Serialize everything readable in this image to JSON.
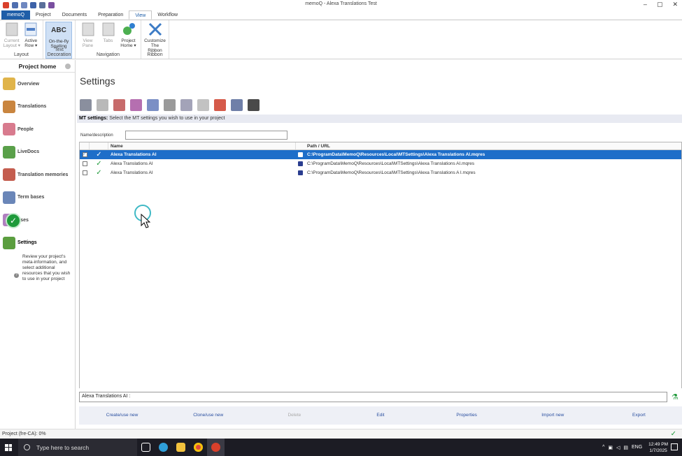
{
  "window": {
    "title": "memoQ - Alexa Translations Test",
    "controls": [
      "–",
      "▢",
      "✕"
    ]
  },
  "ribbon_tabs": [
    "memoQ",
    "Project",
    "Documents",
    "Preparation",
    "View",
    "Workflow"
  ],
  "ribbon": {
    "layout": {
      "label": "Layout",
      "current_layout": "Current Layout ▾",
      "active_row": "Active Row ▾"
    },
    "text_decoration": {
      "label": "Text Decoration",
      "spelling": "On-the-fly Spelling",
      "icon_text": "ABC"
    },
    "navigation": {
      "label": "Navigation",
      "view_pane": "View Pane",
      "tabs": "Tabs",
      "project_home": "Project Home ▾"
    },
    "ribbon_group": {
      "label": "Ribbon",
      "customize": "Customize The Ribbon"
    }
  },
  "nav": {
    "header": "Project home",
    "items": [
      "Overview",
      "Translations",
      "People",
      "LiveDocs",
      "Translation memories",
      "Term bases",
      "uses",
      "Settings"
    ],
    "settings_desc": "Review your project's meta-information, and select additional resources that you wish to use in your project",
    "help": "?"
  },
  "main": {
    "title": "Settings",
    "mt_label": "MT settings:",
    "mt_hint": "Select the MT settings you wish to use in your project",
    "name_desc_label": "Name/description",
    "columns": {
      "name": "Name",
      "path": "Path / URL"
    },
    "rows": [
      {
        "name": "Alexa Translations AI",
        "path": "C:\\ProgramData\\MemoQ\\Resources\\Local\\MTSettings\\Alexa Translations AI.mqres",
        "checked": true,
        "ok": "✓"
      },
      {
        "name": "Alexa Translations AI",
        "path": "C:\\ProgramData\\MemoQ\\Resources\\Local\\MTSettings\\Alexa Translations AI.mqres",
        "checked": false,
        "ok": "✓"
      },
      {
        "name": "Alexa Translations AI",
        "path": "C:\\ProgramData\\MemoQ\\Resources\\Local\\MTSettings\\Alexa Translations A I.mqres",
        "checked": false,
        "ok": "✓"
      }
    ],
    "description": "Alexa Translations AI :",
    "actions": [
      "Create/use new",
      "Clone/use new",
      "Delete",
      "Edit",
      "Properties",
      "Import new",
      "Export"
    ]
  },
  "status": {
    "text": "Project (fre-CA): 0%"
  },
  "taskbar": {
    "search_placeholder": "Type here to search",
    "language": "ENG",
    "time": "12:49 PM",
    "date": "1/7/2025"
  },
  "colors": {
    "accent": "#1e6ec9",
    "app_tab": "#1f5ea8",
    "ok_green": "#1e9a3a"
  }
}
